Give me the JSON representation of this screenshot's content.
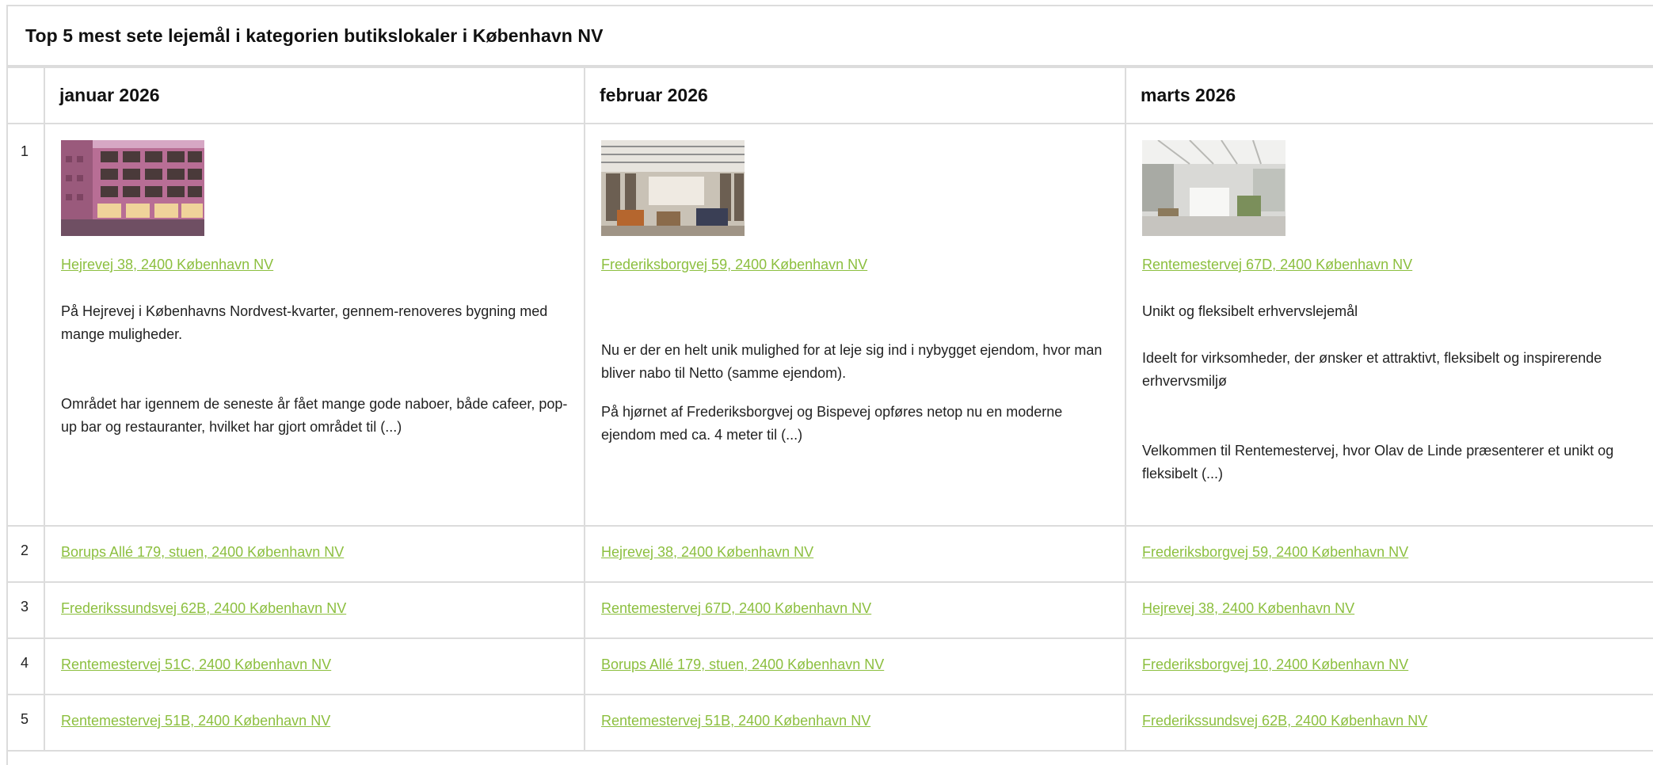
{
  "title": "Top 5 mest sete lejemål i kategorien butikslokaler i København NV",
  "months": [
    "januar 2026",
    "februar 2026",
    "marts 2026"
  ],
  "featured": [
    {
      "address": "Hejrevej 38, 2400 København NV",
      "image_icon": "building-photo",
      "paragraphs": [
        "På Hejrevej i Københavns Nordvest-kvarter, gennem-renoveres bygning med mange muligheder.",
        "Området har igennem de seneste år fået mange gode naboer, både cafeer, pop-up bar og restauranter, hvilket har gjort området til (...)"
      ]
    },
    {
      "address": "Frederiksborgvej 59, 2400 København NV",
      "image_icon": "interior-photo",
      "paragraphs": [
        "Nu er der en helt unik mulighed for at leje sig ind i nybygget ejendom, hvor man bliver nabo til Netto (samme ejendom).",
        "På hjørnet af Frederiksborgvej og Bispevej opføres netop nu en moderne ejendom med ca. 4 meter til (...)"
      ]
    },
    {
      "address": "Rentemestervej 67D, 2400 København NV",
      "image_icon": "showroom-photo",
      "paragraphs": [
        "Unikt og fleksibelt erhvervslejemål",
        "Ideelt for virksomheder, der ønsker et attraktivt, fleksibelt og inspirerende erhvervsmiljø",
        "Velkommen til Rentemestervej, hvor Olav de Linde præsenterer et unikt og fleksibelt (...)"
      ]
    }
  ],
  "rows": [
    {
      "rank": "1"
    },
    {
      "rank": "2",
      "cells": [
        "Borups Allé 179, stuen, 2400 København NV",
        "Hejrevej 38, 2400 København NV",
        "Frederiksborgvej 59, 2400 København NV"
      ]
    },
    {
      "rank": "3",
      "cells": [
        "Frederikssundsvej 62B, 2400 København NV",
        "Rentemestervej 67D, 2400 København NV",
        "Hejrevej 38, 2400 København NV"
      ]
    },
    {
      "rank": "4",
      "cells": [
        "Rentemestervej 51C, 2400 København NV",
        "Borups Allé 179, stuen, 2400 København NV",
        "Frederiksborgvej 10, 2400 København NV"
      ]
    },
    {
      "rank": "5",
      "cells": [
        "Rentemestervej 51B, 2400 København NV",
        "Rentemestervej 51B, 2400 København NV",
        "Frederikssundsvej 62B, 2400 København NV"
      ]
    }
  ],
  "colors": {
    "link": "#8cbf3f",
    "border": "#dcdcdc",
    "text": "#222222"
  }
}
